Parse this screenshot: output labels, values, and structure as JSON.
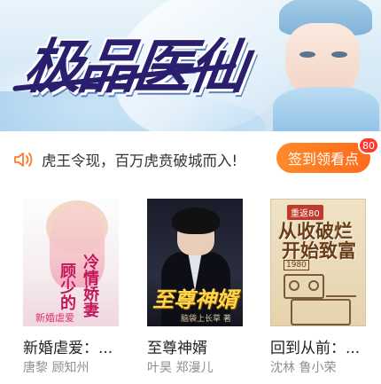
{
  "banner": {
    "title": "极品医仙"
  },
  "notice": {
    "text": "虎王令现，百万虎贲破城而入!",
    "sign_button": "签到领看点",
    "sign_badge": "80"
  },
  "books": [
    {
      "title": "新婚虐爱：...",
      "authors": "唐黎  顾知州",
      "cover": {
        "line1": "冷情娇妻",
        "line2": "顾少的",
        "small": "新婚虐爱"
      }
    },
    {
      "title": "至尊神婿",
      "authors": "叶昊  郑漫儿",
      "cover": {
        "line1": "至尊神婿",
        "author": "脑袋上长草 著"
      }
    },
    {
      "title": "回到从前：...",
      "authors": "沈林  鲁小荣",
      "cover": {
        "tag": "重返80",
        "line1": "从收破烂",
        "line2": "开始致富",
        "year": "1980"
      }
    }
  ],
  "colors": {
    "accent": "#ff7a22",
    "badge": "#ff3b30",
    "title_text": "#222222",
    "author_text": "#8f8f8f"
  }
}
